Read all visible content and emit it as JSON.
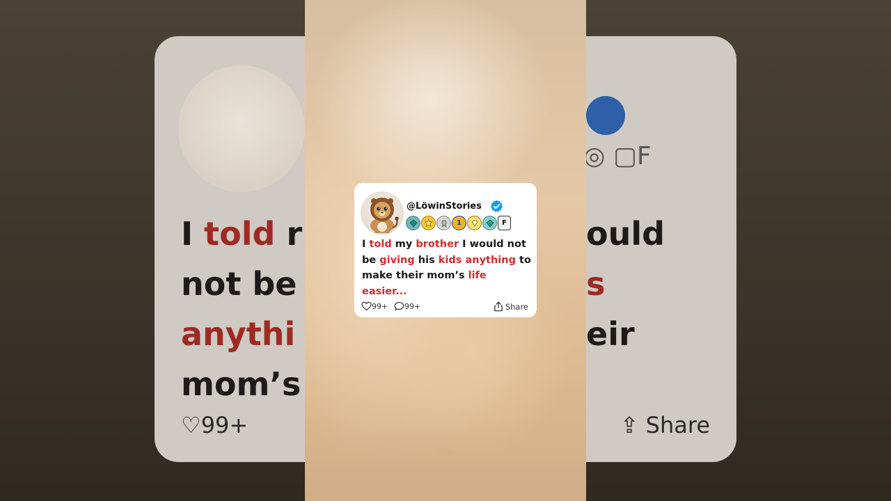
{
  "post": {
    "handle": "@LöwinStories",
    "text_segments": [
      {
        "text": "I ",
        "highlight": false
      },
      {
        "text": "told",
        "highlight": true
      },
      {
        "text": " my ",
        "highlight": false
      },
      {
        "text": "brother",
        "highlight": true
      },
      {
        "text": " I would not be ",
        "highlight": false
      },
      {
        "text": "giving",
        "highlight": true
      },
      {
        "text": " his ",
        "highlight": false
      },
      {
        "text": "kids",
        "highlight": true
      },
      {
        "text": " ",
        "highlight": false
      },
      {
        "text": "anything",
        "highlight": true
      },
      {
        "text": " to make their mom’s ",
        "highlight": false
      },
      {
        "text": "life easier...",
        "highlight": true
      }
    ],
    "likes": "99+",
    "comments": "99+",
    "share_label": "Share",
    "badges": [
      "green-gem-icon",
      "gold-star-icon",
      "silver-ribbon-icon",
      "one-medal-icon",
      "diamond-icon",
      "green-gem-icon",
      "letter-f-icon"
    ],
    "badge_f_letter": "F",
    "highlight_color": "#d62b2b",
    "verified_color": "#1d9bf0"
  },
  "background_echo": {
    "line1_a": "I ",
    "line1_b": "told",
    "line1_c": " r",
    "line1_d": "ould",
    "line2_a": "not be",
    "line2_b": "s",
    "line3_a": "anythi",
    "line3_b": "eir",
    "line4_a": "mom’s",
    "likes": "99+",
    "share_label": "Share",
    "badge_f_letter": "F"
  }
}
